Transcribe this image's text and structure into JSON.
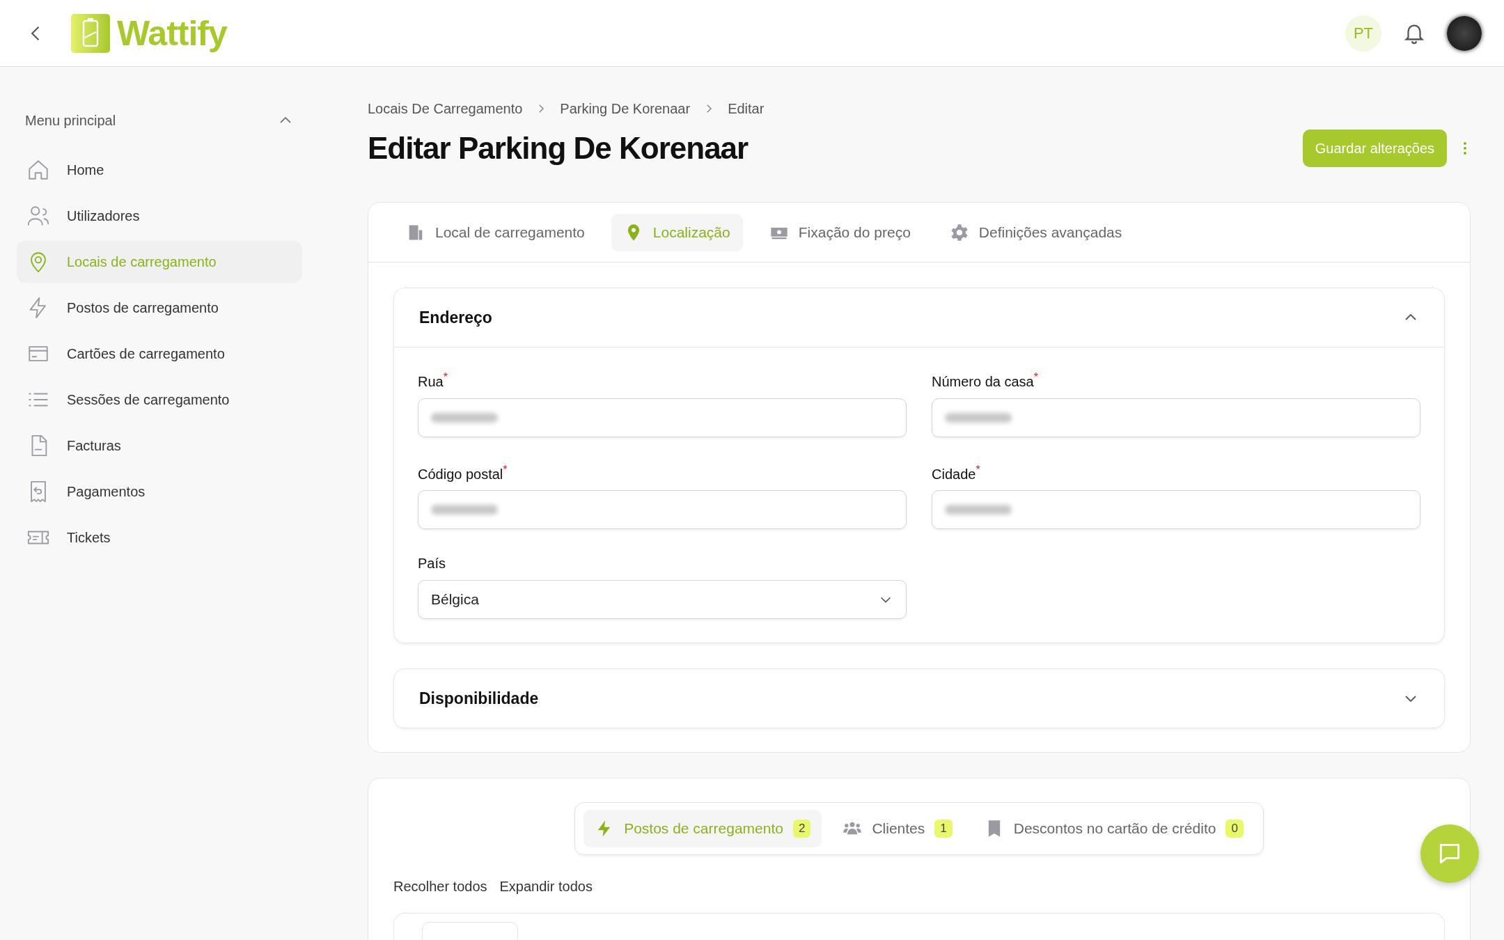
{
  "header": {
    "logo": "Wattify",
    "language": "PT"
  },
  "sidebar": {
    "title": "Menu principal",
    "expanded": true,
    "items": [
      {
        "label": "Home",
        "selected": false
      },
      {
        "label": "Utilizadores",
        "selected": false
      },
      {
        "label": "Locais de carregamento",
        "selected": true
      },
      {
        "label": "Postos de carregamento",
        "selected": false
      },
      {
        "label": "Cartões de carregamento",
        "selected": false
      },
      {
        "label": "Sessões de carregamento",
        "selected": false
      },
      {
        "label": "Facturas",
        "selected": false
      },
      {
        "label": "Pagamentos",
        "selected": false
      },
      {
        "label": "Tickets",
        "selected": false
      }
    ]
  },
  "breadcrumbs": [
    "Locais De Carregamento",
    "Parking De Korenaar",
    "Editar"
  ],
  "title": "Editar Parking De Korenaar",
  "save_button": "Guardar alterações",
  "tabs": [
    {
      "label": "Local de carregamento",
      "selected": false
    },
    {
      "label": "Localização",
      "selected": true
    },
    {
      "label": "Fixação do preço",
      "selected": false
    },
    {
      "label": "Definições avançadas",
      "selected": false
    }
  ],
  "sections": [
    {
      "title": "Endereço",
      "expanded": true,
      "fields": [
        {
          "label": "Rua",
          "required_mark": "*",
          "kind": "text",
          "redacted": true
        },
        {
          "label": "Número da casa",
          "required_mark": "*",
          "kind": "text",
          "redacted": true
        },
        {
          "label": "Código postal",
          "required_mark": "*",
          "kind": "text",
          "redacted": true
        },
        {
          "label": "Cidade",
          "required_mark": "*",
          "kind": "text",
          "redacted": true
        },
        {
          "label": "País",
          "kind": "select",
          "value": "Bélgica"
        }
      ]
    },
    {
      "title": "Disponibilidade",
      "expanded": false
    }
  ],
  "sub_tabs": [
    {
      "label": "Postos de carregamento",
      "count": "2",
      "selected": true
    },
    {
      "label": "Clientes",
      "count": "1",
      "selected": false
    },
    {
      "label": "Descontos no cartão de crédito",
      "count": "0",
      "selected": false
    }
  ],
  "actions": [
    "Recolher todos",
    "Expandir todos"
  ]
}
